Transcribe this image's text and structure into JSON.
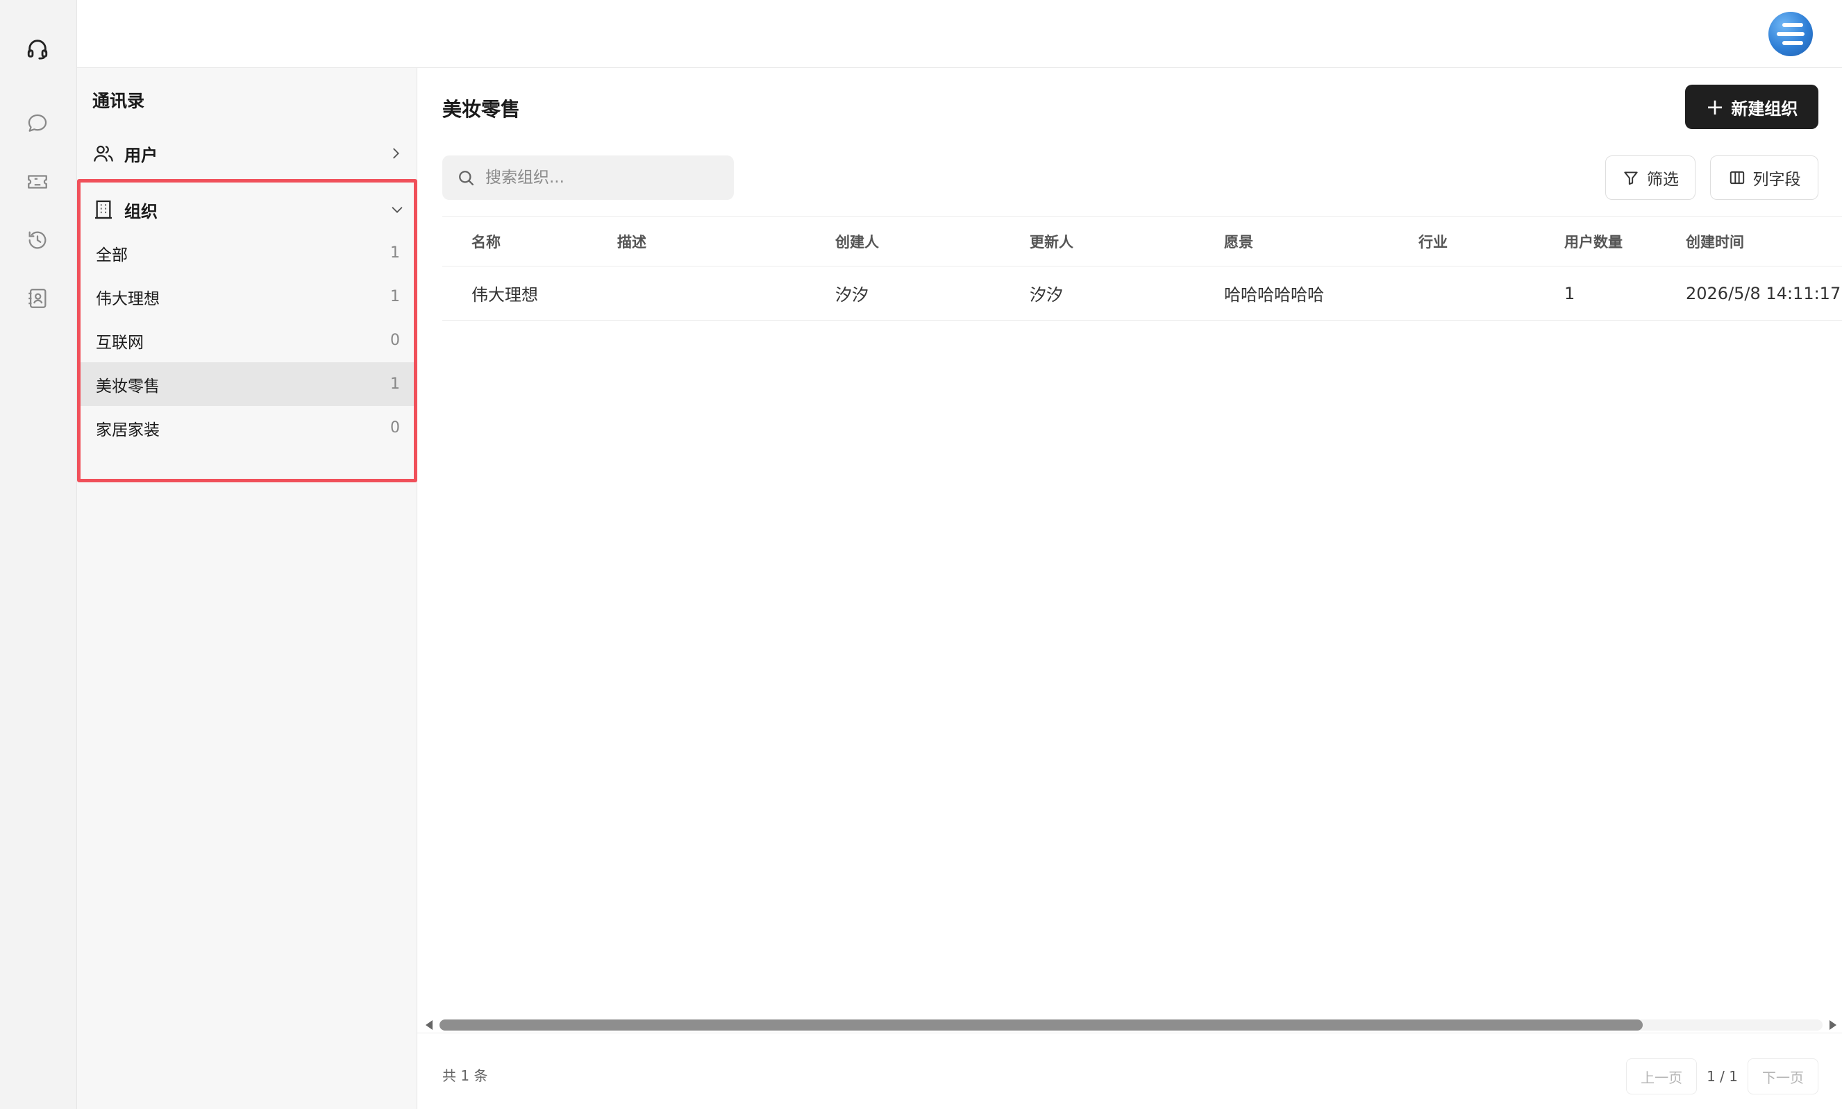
{
  "rail": {
    "icons": [
      "headset-icon",
      "chat-icon",
      "ticket-icon",
      "history-icon",
      "contacts-icon"
    ]
  },
  "header": {
    "avatar_icon": "avatar-logo-icon",
    "avatar_color": "#2f7fd6"
  },
  "sidebar": {
    "title": "通讯录",
    "users_label": "用户",
    "org_label": "组织",
    "highlight_color": "#f0505a",
    "org_items": [
      {
        "name": "全部",
        "count": "1"
      },
      {
        "name": "伟大理想",
        "count": "1"
      },
      {
        "name": "互联网",
        "count": "0"
      },
      {
        "name": "美妆零售",
        "count": "1",
        "active": true
      },
      {
        "name": "家居家装",
        "count": "0"
      }
    ]
  },
  "main": {
    "title": "美妆零售",
    "new_button": "新建组织",
    "search_placeholder": "搜索组织...",
    "filter_button": "筛选",
    "columns_button": "列字段",
    "table": {
      "headers": [
        "名称",
        "描述",
        "创建人",
        "更新人",
        "愿景",
        "行业",
        "用户数量",
        "创建时间"
      ],
      "rows": [
        [
          "伟大理想",
          "",
          "汐汐",
          "汐汐",
          "哈哈哈哈哈哈",
          "",
          "1",
          "2026/5/8 14:11:17"
        ]
      ]
    },
    "scroll_fraction": 0.87,
    "total_text": "共 1 条",
    "pagination": {
      "prev": "上一页",
      "info": "1 / 1",
      "next": "下一页"
    }
  }
}
